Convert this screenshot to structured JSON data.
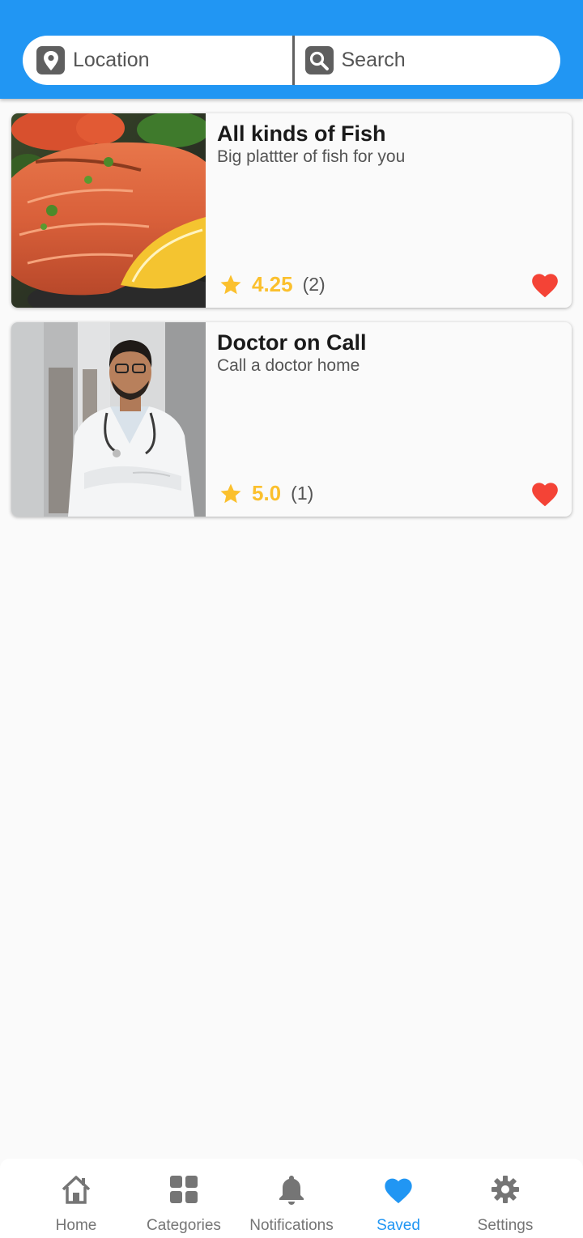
{
  "search_bar": {
    "location_label": "Location",
    "search_label": "Search",
    "location_icon": "map-pin-icon",
    "search_icon": "search-icon"
  },
  "listings": [
    {
      "title": "All kinds of Fish",
      "subtitle": "Big plattter of fish for you",
      "rating": "4.25",
      "review_count": "(2)",
      "favorited": true
    },
    {
      "title": "Doctor on Call",
      "subtitle": "Call a doctor home",
      "rating": "5.0",
      "review_count": "(1)",
      "favorited": true
    }
  ],
  "bottom_nav": {
    "items": [
      {
        "label": "Home",
        "icon": "home-icon",
        "active": false
      },
      {
        "label": "Categories",
        "icon": "grid-icon",
        "active": false
      },
      {
        "label": "Notifications",
        "icon": "bell-icon",
        "active": false
      },
      {
        "label": "Saved",
        "icon": "heart-icon",
        "active": true
      },
      {
        "label": "Settings",
        "icon": "gear-icon",
        "active": false
      }
    ]
  },
  "colors": {
    "primary": "#2196f3",
    "rating": "#fbc02d",
    "favorite": "#f44336",
    "nav_inactive": "#757575"
  }
}
